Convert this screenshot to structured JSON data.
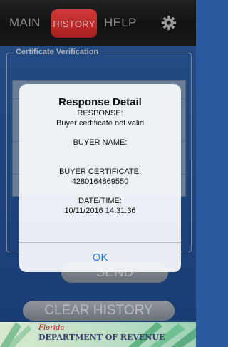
{
  "tabs": {
    "main": "MAIN",
    "history": "HISTORY",
    "help": "HELP"
  },
  "section": {
    "legend": "Certificate Verification"
  },
  "buttons": {
    "send": "SEND",
    "clear_history": "CLEAR HISTORY"
  },
  "footer": {
    "state": "Florida",
    "department": "DEPARTMENT OF REVENUE"
  },
  "dialog": {
    "title": "Response Detail",
    "response_label": "RESPONSE:",
    "response_value": "Buyer certificate not valid",
    "buyer_name_label": "BUYER NAME:",
    "buyer_certificate_label": "BUYER CERTIFICATE:",
    "buyer_certificate_value": "4280164869550",
    "datetime_label": "DATE/TIME:",
    "datetime_value": "10/11/2016 14:31:36",
    "ok": "OK"
  },
  "icons": {
    "settings": "gear-icon"
  },
  "colors": {
    "accent_red": "#c22b2b",
    "ios_blue": "#1a7ef0",
    "background_blue": "#2a5aa0"
  }
}
